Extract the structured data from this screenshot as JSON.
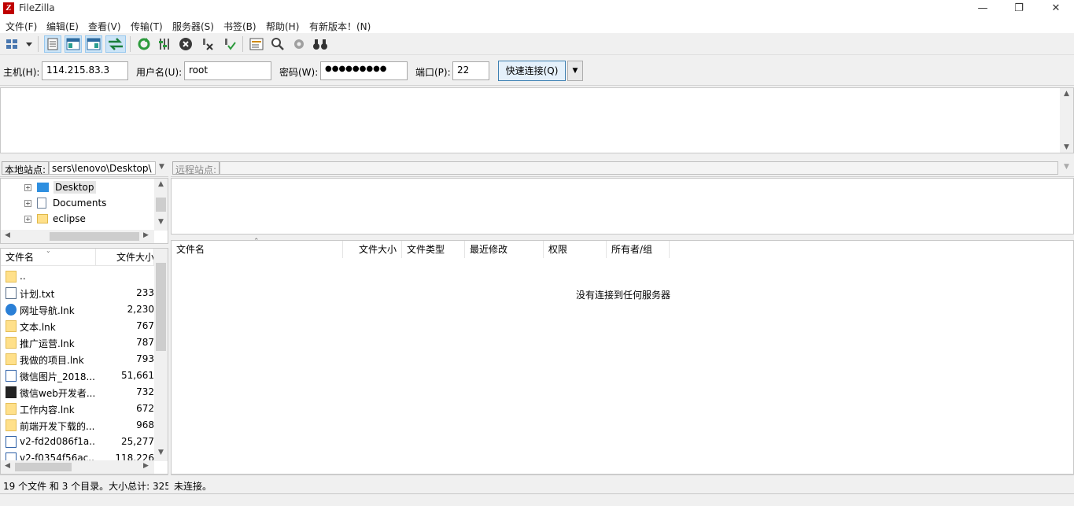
{
  "window": {
    "title": "FileZilla",
    "icon_letter": "Z",
    "min": "—",
    "max": "❐",
    "close": "✕"
  },
  "menu": [
    "文件(F)",
    "编辑(E)",
    "查看(V)",
    "传输(T)",
    "服务器(S)",
    "书签(B)",
    "帮助(H)",
    "有新版本！(N)"
  ],
  "quickconnect": {
    "host_label": "主机(H):",
    "host": "114.215.83.3",
    "user_label": "用户名(U):",
    "user": "root",
    "pass_label": "密码(W):",
    "pass": "●●●●●●●●●",
    "port_label": "端口(P):",
    "port": "22",
    "button": "快速连接(Q)"
  },
  "local": {
    "label": "本地站点:",
    "path": "sers\\lenovo\\Desktop\\",
    "tree": [
      "Desktop",
      "Documents",
      "eclipse"
    ],
    "columns": [
      "文件名",
      "文件大小"
    ],
    "files": [
      {
        "name": "..",
        "size": "",
        "icon": "folder"
      },
      {
        "name": "计划.txt",
        "size": "233",
        "icon": "txt"
      },
      {
        "name": "网址导航.lnk",
        "size": "2,230",
        "icon": "ie"
      },
      {
        "name": "文本.lnk",
        "size": "767",
        "icon": "folder"
      },
      {
        "name": "推广运营.lnk",
        "size": "787",
        "icon": "folder"
      },
      {
        "name": "我做的项目.lnk",
        "size": "793",
        "icon": "folder"
      },
      {
        "name": "微信图片_2018...",
        "size": "51,661",
        "icon": "img"
      },
      {
        "name": "微信web开发者...",
        "size": "732",
        "icon": "cmd"
      },
      {
        "name": "工作内容.lnk",
        "size": "672",
        "icon": "folder"
      },
      {
        "name": "前端开发下载的...",
        "size": "968",
        "icon": "folder"
      },
      {
        "name": "v2-fd2d086f1a...",
        "size": "25,277",
        "icon": "img"
      },
      {
        "name": "v2-f0354f56ac...",
        "size": "118,226",
        "icon": "img"
      }
    ],
    "status": "19 个文件 和 3 个目录。大小总计: 325"
  },
  "remote": {
    "label": "远程站点:",
    "path": "",
    "columns": [
      "文件名",
      "文件大小",
      "文件类型",
      "最近修改",
      "权限",
      "所有者/组"
    ],
    "empty_message": "没有连接到任何服务器",
    "status": "未连接。"
  },
  "colors": {
    "accent": "#3c7fb1",
    "app_red": "#bf0000"
  }
}
